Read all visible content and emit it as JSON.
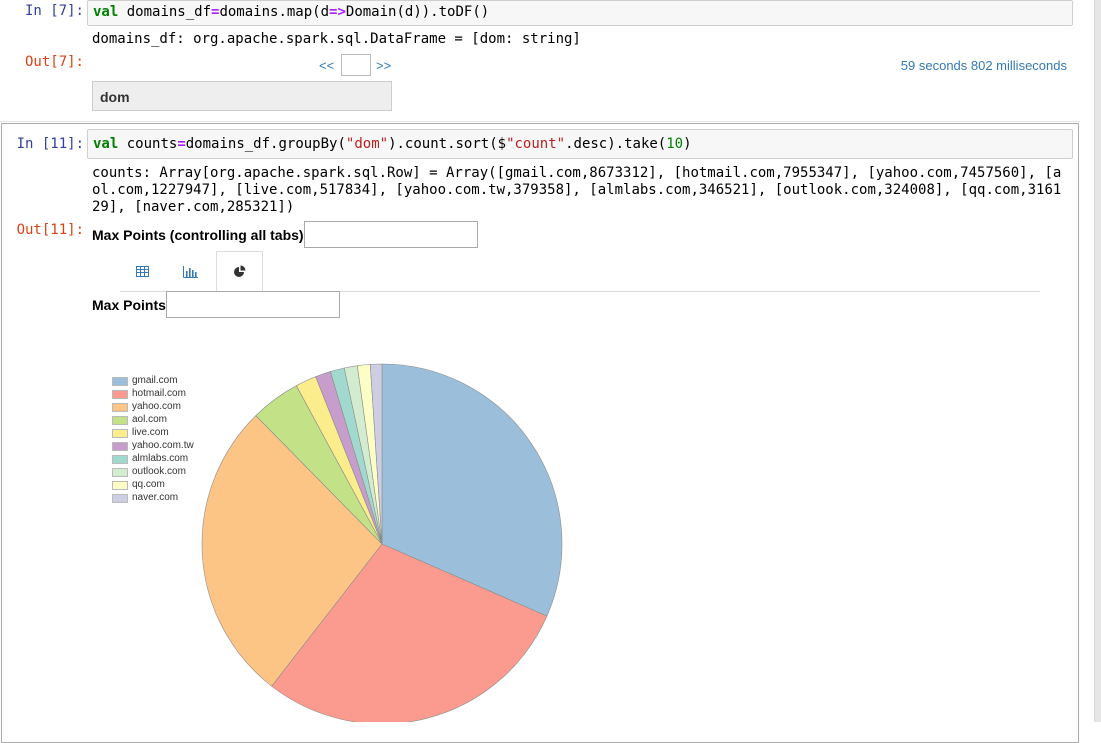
{
  "cells": [
    {
      "in_prompt": "In [7]:",
      "code": {
        "kw": "val",
        "name": " domains_df",
        "op": "=",
        "rest1": "domains.map(d",
        "arrow": "=>",
        "rest2": "Domain(d)).toDF()"
      },
      "out_text": "domains_df: org.apache.spark.sql.DataFrame = [dom: string]",
      "out_prompt": "Out[7]:",
      "prev_label": "<<",
      "next_label": ">>",
      "timing": "59 seconds 802 milliseconds",
      "table_header": "dom"
    },
    {
      "in_prompt": "In [11]:",
      "code": {
        "kw": "val",
        "name": " counts",
        "op": "=",
        "rest1": "domains_df.groupBy(",
        "str1": "\"dom\"",
        "rest2": ").count.sort($",
        "str2": "\"count\"",
        "rest3": ".desc).take(",
        "num": "10",
        "rest4": ")"
      },
      "out_lines": [
        "counts: Array[org.apache.spark.sql.Row] = Array([gmail.com,8673312], [hotmail.com,7955347], [yahoo.com,7457560], [a",
        "ol.com,1227947], [live.com,517834], [yahoo.com.tw,379358], [almlabs.com,346521], [outlook.com,324008], [qq.com,3161",
        "29], [naver.com,285321])"
      ],
      "out_prompt": "Out[11]:",
      "max_points_all_label": "Max Points (controlling all tabs)",
      "max_points_label": "Max Points",
      "max_points_all_value": "",
      "max_points_value": "",
      "tabs": [
        {
          "icon": "table-icon",
          "active": false
        },
        {
          "icon": "bar-chart-icon",
          "active": false
        },
        {
          "icon": "pie-chart-icon",
          "active": true
        }
      ]
    }
  ],
  "chart_data": {
    "type": "pie",
    "categories": [
      "gmail.com",
      "hotmail.com",
      "yahoo.com",
      "aol.com",
      "live.com",
      "yahoo.com.tw",
      "almlabs.com",
      "outlook.com",
      "qq.com",
      "naver.com"
    ],
    "values": [
      8673312,
      7955347,
      7457560,
      1227947,
      517834,
      379358,
      346521,
      324008,
      316129,
      285321
    ],
    "colors": [
      "#9bbfdb",
      "#fb9a8e",
      "#fdc585",
      "#c3e287",
      "#fbec8c",
      "#c79dcc",
      "#a2d9cf",
      "#d3ecd0",
      "#fdfdc6",
      "#cdcde4"
    ],
    "legend_position": "top-left",
    "title": ""
  }
}
